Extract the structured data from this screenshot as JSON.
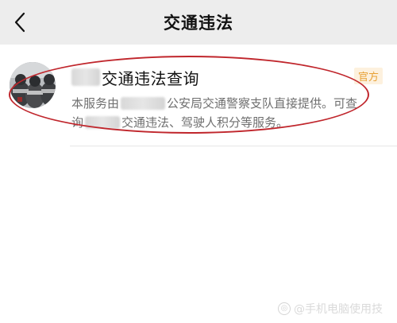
{
  "header": {
    "title": "交通违法",
    "back_icon": "chevron-left-icon"
  },
  "service_card": {
    "title": "交通违法查询",
    "badge": "官方",
    "badge_color": "#e8a135",
    "description": {
      "line1_prefix": "本服务由",
      "line1_suffix": "公安局交通警察支队直接提供。可查",
      "line2_prefix": "询",
      "line2_suffix": "交通违法、驾驶人积分等服务。"
    },
    "avatar_icon": "police-photo-avatar"
  },
  "annotation": {
    "color": "#c0262c"
  },
  "watermark": {
    "text": "@手机电脑使用技"
  }
}
